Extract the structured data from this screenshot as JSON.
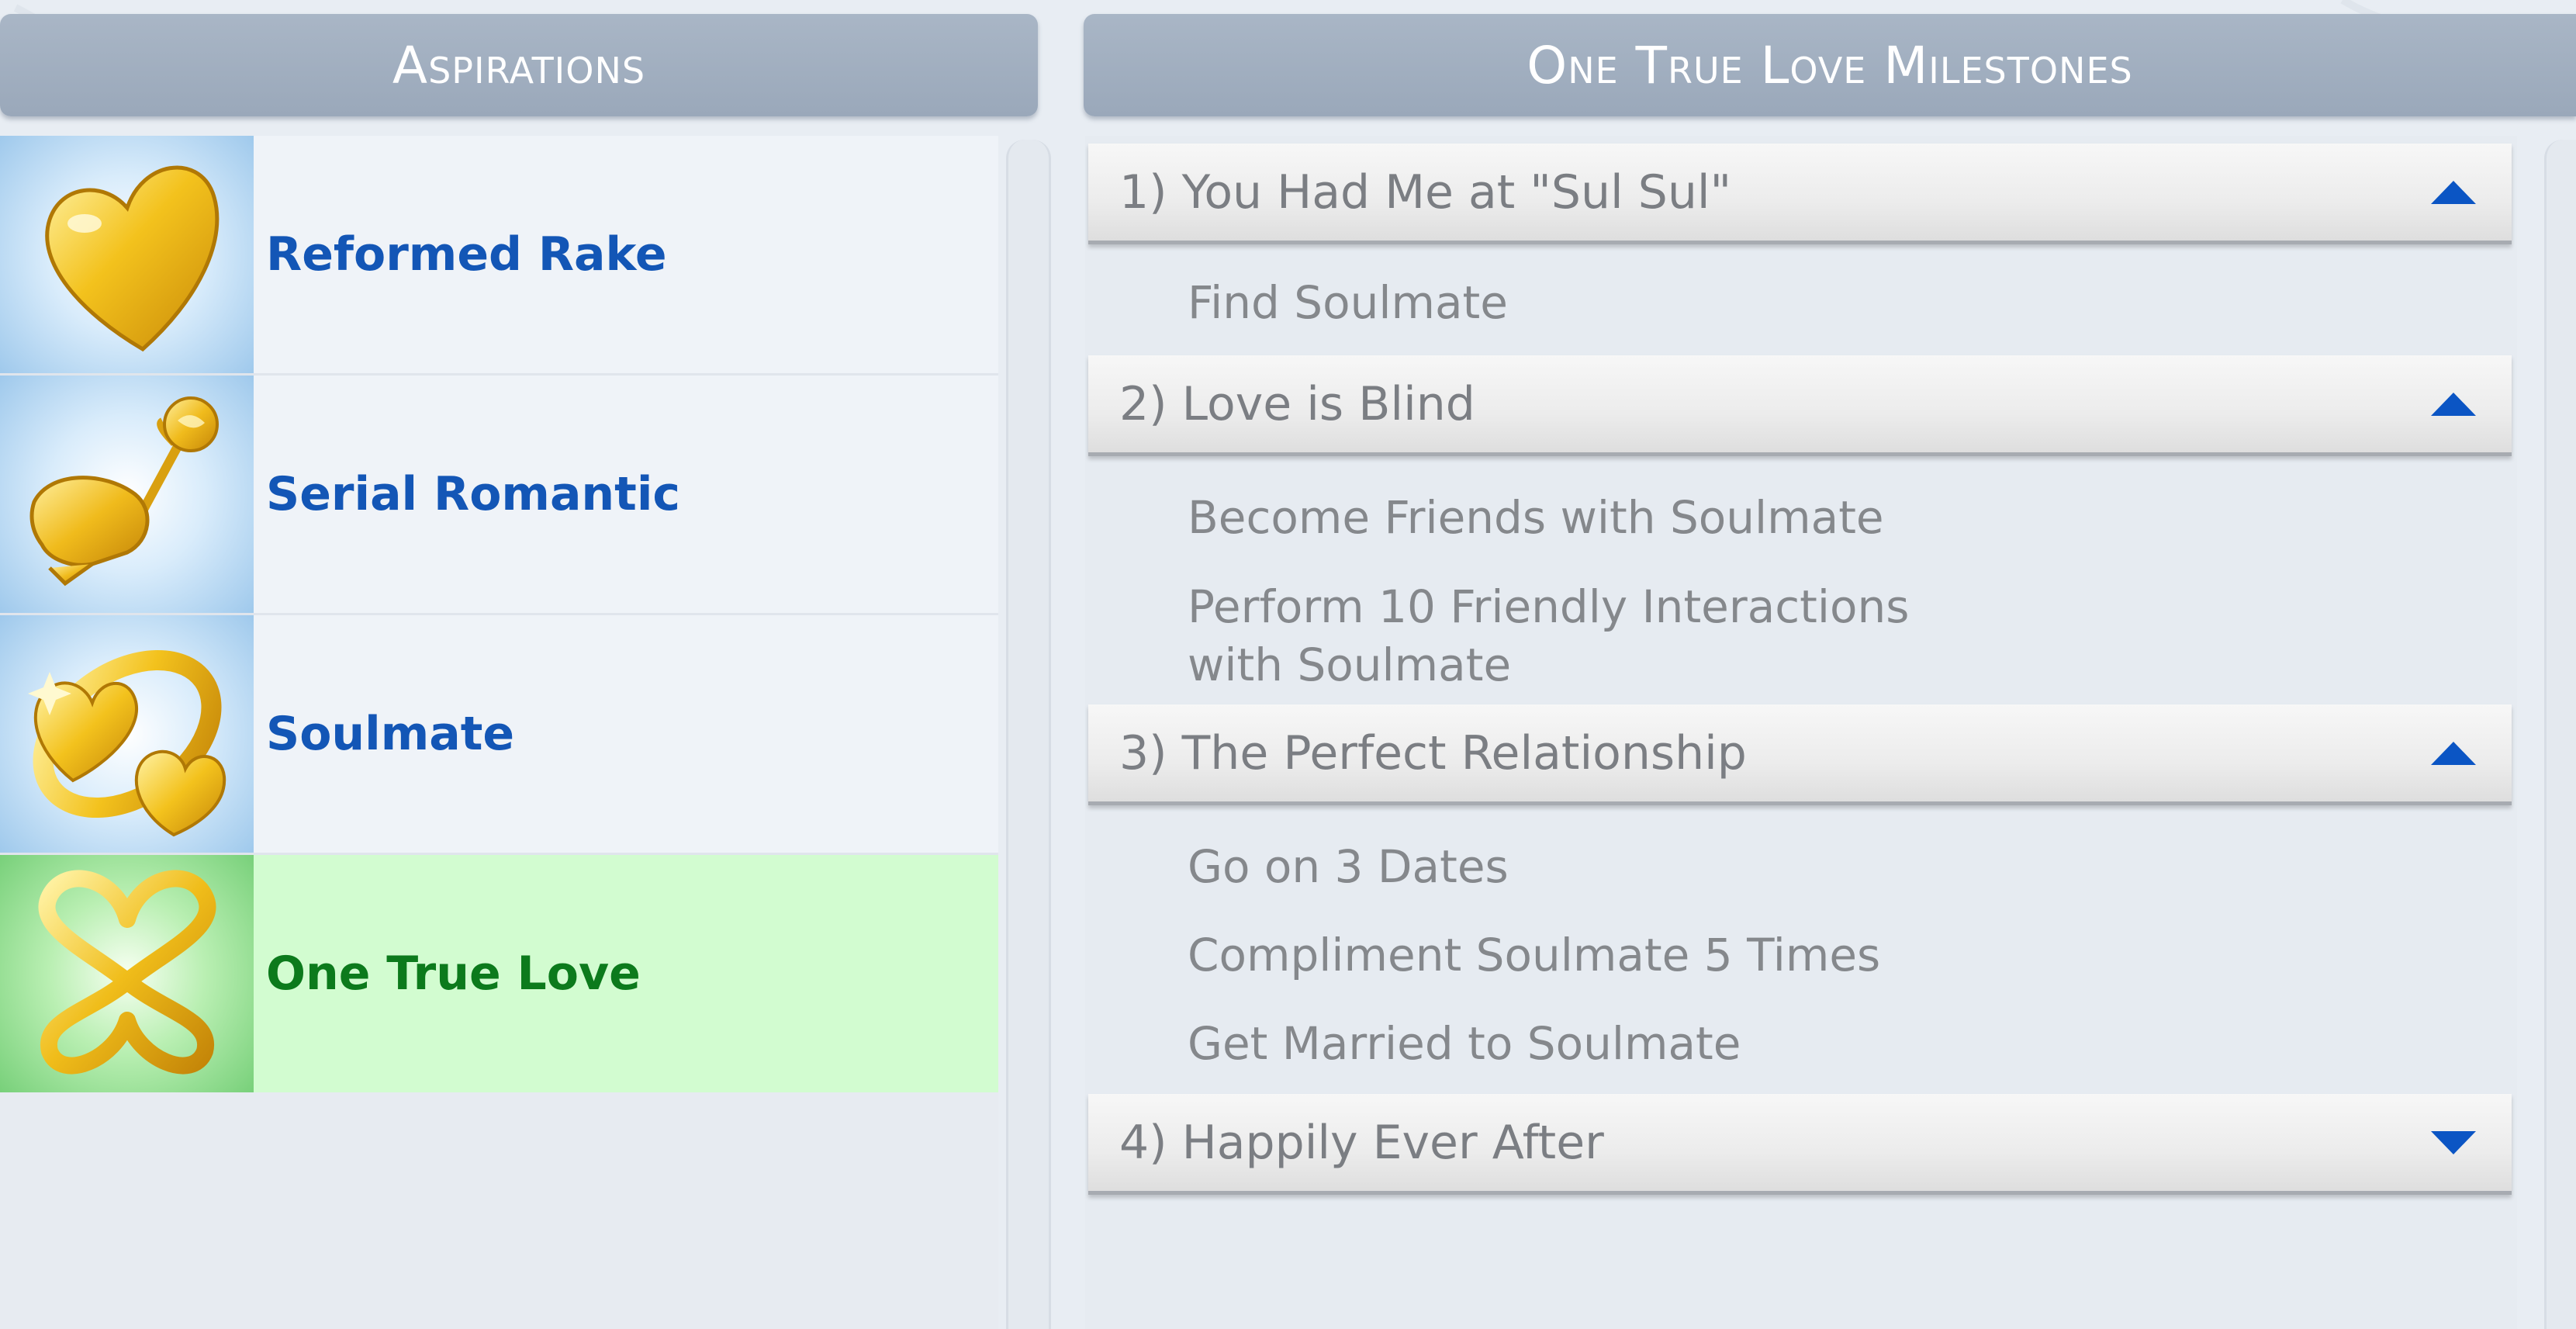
{
  "left_header": "Aspirations",
  "right_header": "One True Love Milestones",
  "aspirations": [
    {
      "label": "Reformed Rake",
      "icon": "golden-heart-icon",
      "selected": false
    },
    {
      "label": "Serial Romantic",
      "icon": "hand-holding-rose-icon",
      "selected": false
    },
    {
      "label": "Soulmate",
      "icon": "linked-hearts-icon",
      "selected": false
    },
    {
      "label": "One True Love",
      "icon": "heart-infinity-icon",
      "selected": true
    }
  ],
  "milestones": [
    {
      "title": "1) You Had Me at \"Sul Sul\"",
      "expanded": true,
      "items": [
        "Find Soulmate"
      ]
    },
    {
      "title": "2) Love is Blind",
      "expanded": true,
      "items": [
        "Become Friends with Soulmate",
        "Perform 10 Friendly Interactions",
        "with Soulmate"
      ]
    },
    {
      "title": "3) The Perfect Relationship",
      "expanded": true,
      "items": [
        "Go on 3 Dates",
        "Compliment Soulmate 5 Times",
        "Get Married to Soulmate"
      ]
    },
    {
      "title": "4) Happily Ever After",
      "expanded": false,
      "items": []
    }
  ],
  "colors": {
    "header_bg": "#a9b6c6",
    "aspiration_text": "#1356b6",
    "selected_text": "#0c7a1c",
    "selected_bg": "#d2fcd0",
    "arrow": "#0b55c4"
  }
}
